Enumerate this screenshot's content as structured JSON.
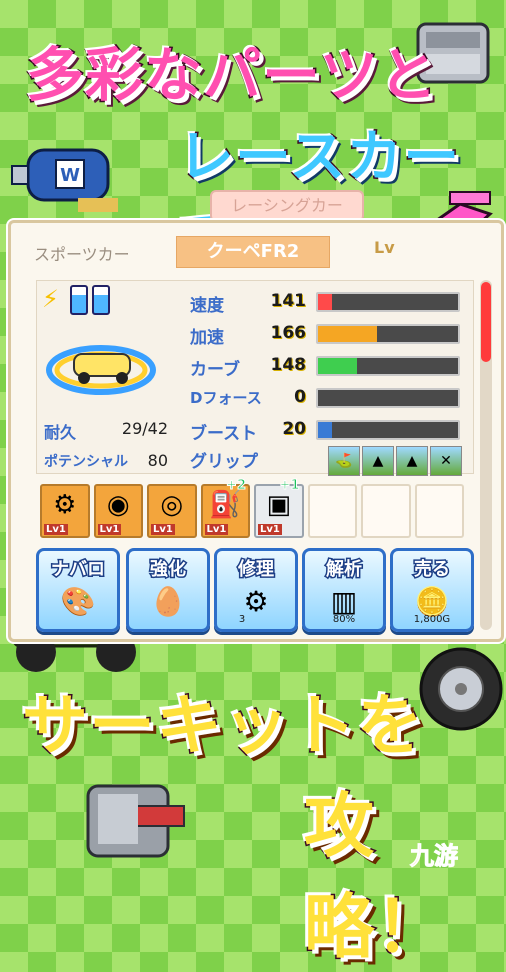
{
  "headline": {
    "line1": "多彩なパーツと",
    "line2": "レースカーで",
    "line3": "サーキットを",
    "line4": "攻略！"
  },
  "panel": {
    "title": "レーシングカー",
    "category": "スポーツカー",
    "car_name": "クーペFR2",
    "level_label": "Lv",
    "stats": [
      {
        "label": "速度",
        "value": "141",
        "fill": 0.1,
        "color": "#ff4a4a"
      },
      {
        "label": "加速",
        "value": "166",
        "fill": 0.42,
        "color": "#f5a623"
      },
      {
        "label": "カーブ",
        "value": "148",
        "fill": 0.28,
        "color": "#3fce4f"
      },
      {
        "label": "Dフォース",
        "value": "0",
        "fill": 0.0,
        "color": "#3a7bd5"
      },
      {
        "label": "ブースト",
        "value": "20",
        "fill": 0.1,
        "color": "#3a7bd5"
      }
    ],
    "durability": {
      "label": "耐久",
      "value": "29/42"
    },
    "potential": {
      "label": "ポテンシャル",
      "value": "80"
    },
    "grip": {
      "label": "グリップ",
      "icons": [
        "road-icon",
        "mountain-icon",
        "mountain-icon",
        "snow-icon"
      ]
    }
  },
  "parts": [
    {
      "icon": "engine-icon",
      "level": "Lv1",
      "plus": ""
    },
    {
      "icon": "tire-icon",
      "level": "Lv1",
      "plus": ""
    },
    {
      "icon": "wheel-icon",
      "level": "Lv1",
      "plus": ""
    },
    {
      "icon": "fuel-can-icon",
      "level": "Lv1",
      "plus": "+2"
    },
    {
      "icon": "chip-icon",
      "level": "Lv1",
      "plus": "+1"
    },
    {
      "icon": "",
      "level": "",
      "plus": ""
    },
    {
      "icon": "",
      "level": "",
      "plus": ""
    },
    {
      "icon": "",
      "level": "",
      "plus": ""
    }
  ],
  "buttons": [
    {
      "label": "ナバロ",
      "icon": "paint-icon",
      "sub": ""
    },
    {
      "label": "強化",
      "icon": "egg-icon",
      "sub": ""
    },
    {
      "label": "修理",
      "icon": "gear-icon",
      "sub": "3"
    },
    {
      "label": "解析",
      "icon": "bars-icon",
      "sub": "80%"
    },
    {
      "label": "売る",
      "icon": "coin-icon",
      "sub": "1,800G"
    }
  ],
  "watermark": "九游"
}
